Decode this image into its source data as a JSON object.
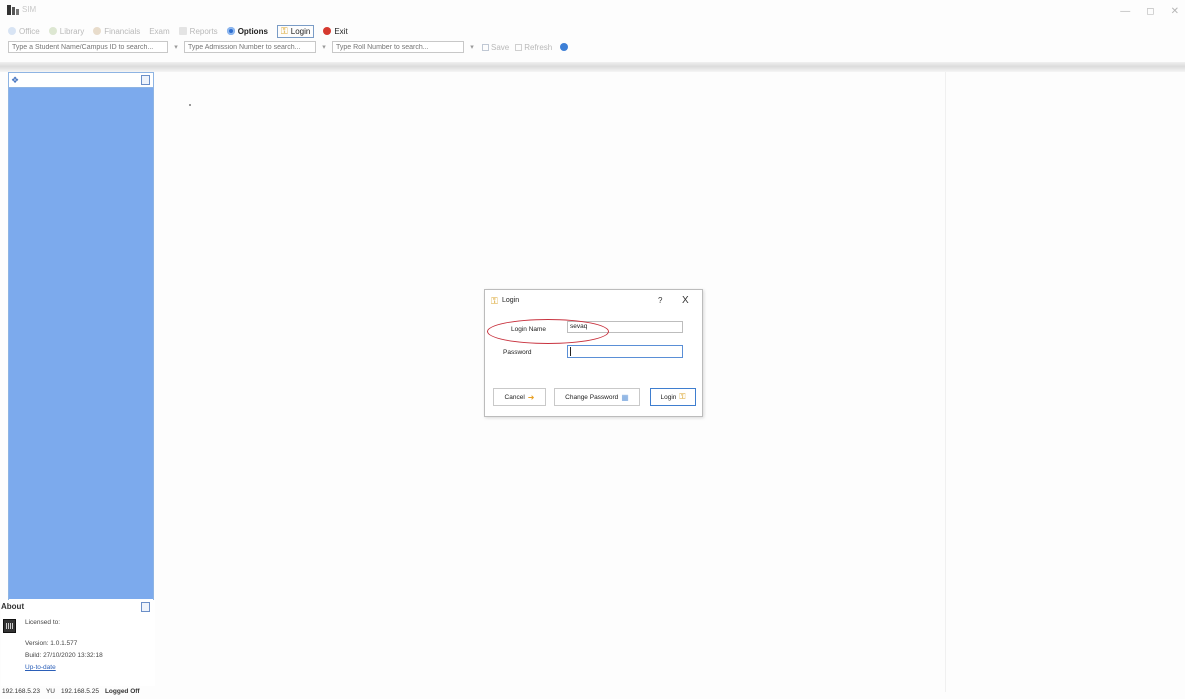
{
  "window": {
    "title": "SIM"
  },
  "menu": {
    "items": [
      {
        "label": "Office",
        "state": "disabled",
        "icon": "office-icon"
      },
      {
        "label": "Library",
        "state": "disabled",
        "icon": "library-icon"
      },
      {
        "label": "Financials",
        "state": "disabled",
        "icon": "financials-icon"
      },
      {
        "label": "Exam",
        "state": "disabled",
        "icon": "exam-icon"
      },
      {
        "label": "Reports",
        "state": "disabled",
        "icon": "reports-icon"
      },
      {
        "label": "Options",
        "state": "enabled",
        "icon": "options-icon"
      },
      {
        "label": "Login",
        "state": "enabled",
        "icon": "key-icon"
      },
      {
        "label": "Exit",
        "state": "enabled",
        "icon": "exit-icon"
      }
    ]
  },
  "search": {
    "student_placeholder": "Type a Student Name/Campus ID to search...",
    "admission_placeholder": "Type Admission Number to search...",
    "roll_placeholder": "Type Roll Number to search...",
    "save_label": "Save",
    "refresh_label": "Refresh"
  },
  "about": {
    "title": "About",
    "licensed_to": "Licensed to:",
    "version": "Version: 1.0.1.577",
    "build": "Build: 27/10/2020 13:32:18",
    "status_link": "Up-to-date"
  },
  "statusbar": {
    "ip1": "192.168.5.23",
    "yu": "YU",
    "ip2": "192.168.5.25",
    "state": "Logged Off"
  },
  "dialog": {
    "title": "Login",
    "help": "?",
    "close": "X",
    "login_name_label": "Login Name",
    "login_name_value": "sevaq",
    "password_label": "Password",
    "cancel_label": "Cancel",
    "change_password_label": "Change Password",
    "login_label": "Login"
  },
  "colors": {
    "sidebar_blue": "#7caaed",
    "focus_blue": "#3f7ecf",
    "highlight_red": "#c8323e"
  }
}
